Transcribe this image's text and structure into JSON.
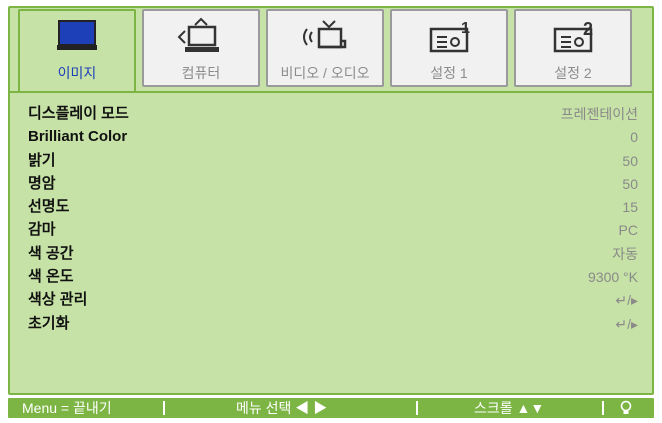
{
  "tabs": [
    {
      "label": "이미지",
      "icon": "monitor-icon",
      "active": true
    },
    {
      "label": "컴퓨터",
      "icon": "computer-icon",
      "active": false
    },
    {
      "label": "비디오 / 오디오",
      "icon": "video-audio-icon",
      "active": false
    },
    {
      "label": "설정 1",
      "icon": "projector-setup1-icon",
      "active": false
    },
    {
      "label": "설정 2",
      "icon": "projector-setup2-icon",
      "active": false
    }
  ],
  "rows": [
    {
      "label": "디스플레이 모드",
      "value": "프레젠테이션"
    },
    {
      "label": "Brilliant Color",
      "value": "0"
    },
    {
      "label": "밝기",
      "value": "50"
    },
    {
      "label": "명암",
      "value": "50"
    },
    {
      "label": "선명도",
      "value": "15"
    },
    {
      "label": "감마",
      "value": "PC"
    },
    {
      "label": "색 공간",
      "value": "자동"
    },
    {
      "label": "색 온도",
      "value": "9300 °K"
    },
    {
      "label": "색상 관리",
      "value": "↵/▸"
    },
    {
      "label": "초기화",
      "value": "↵/▸"
    }
  ],
  "footer": {
    "menu_exit": "Menu = 끝내기",
    "menu_select": "메뉴 선택 ◀ ▶",
    "scroll": "스크롤 ▲▼",
    "bulb_icon": "lamp-icon"
  },
  "colors": {
    "panel_bg": "#c6e2a6",
    "accent": "#7db545",
    "active_label": "#1d3fb8"
  }
}
